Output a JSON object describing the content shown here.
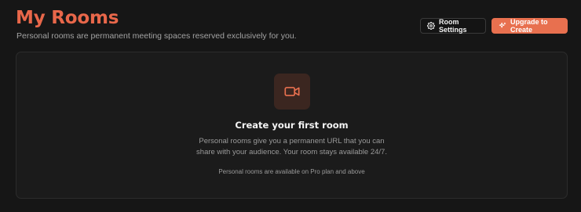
{
  "header": {
    "title": "My Rooms",
    "subtitle": "Personal rooms are permanent meeting spaces reserved exclusively for you."
  },
  "actions": {
    "room_settings_label": "Room Settings",
    "room_settings_icon": "gear-icon",
    "upgrade_label": "Upgrade to Create",
    "upgrade_icon": "sparkle-icon"
  },
  "empty_state": {
    "icon": "video-camera-icon",
    "title": "Create your first room",
    "description_line1": "Personal rooms give you a permanent URL that you can",
    "description_line2": "share with your audience. Your room stays available 24/7.",
    "note": "Personal rooms are available on Pro plan and above"
  },
  "colors": {
    "accent": "#e8674a",
    "background": "#161616",
    "panel": "#1b1b1b"
  }
}
